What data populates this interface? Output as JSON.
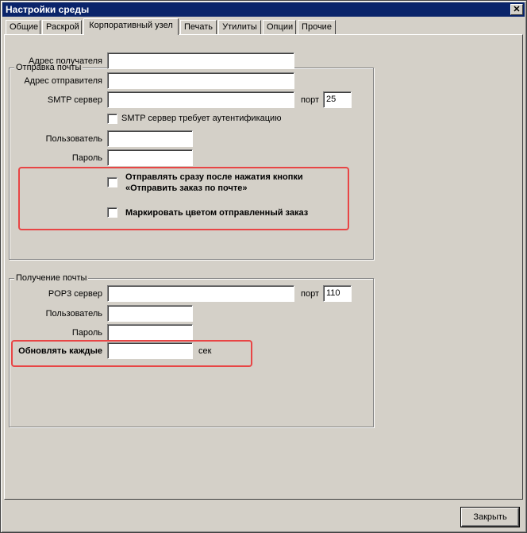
{
  "window": {
    "title": "Настройки среды",
    "close_glyph": "✕"
  },
  "tabs": [
    "Общие",
    "Раскрой",
    "Корпоративный узел",
    "Печать",
    "Утилиты",
    "Опции",
    "Прочие"
  ],
  "send": {
    "title": "Отправка почты",
    "recipient_label": "Адрес получателя",
    "recipient_value": "",
    "sender_label": "Адрес отправителя",
    "sender_value": "",
    "smtp_label": "SMTP сервер",
    "smtp_value": "",
    "port_label": "порт",
    "port_value": "25",
    "auth_label": "SMTP сервер требует аутентификацию",
    "user_label": "Пользователь",
    "user_value": "",
    "password_label": "Пароль",
    "password_value": "",
    "send_immediately_label_1": "Отправлять сразу после нажатия кнопки",
    "send_immediately_label_2": "«Отправить заказ по почте»",
    "mark_color_label": "Маркировать цветом отправленный заказ"
  },
  "receive": {
    "title": "Получение почты",
    "pop3_label": "POP3 сервер",
    "pop3_value": "",
    "port_label": "порт",
    "port_value": "110",
    "user_label": "Пользователь",
    "user_value": "",
    "password_label": "Пароль",
    "password_value": "",
    "refresh_label": "Обновлять каждые",
    "refresh_value": "",
    "refresh_unit": "сек"
  },
  "footer": {
    "close_label": "Закрыть"
  }
}
